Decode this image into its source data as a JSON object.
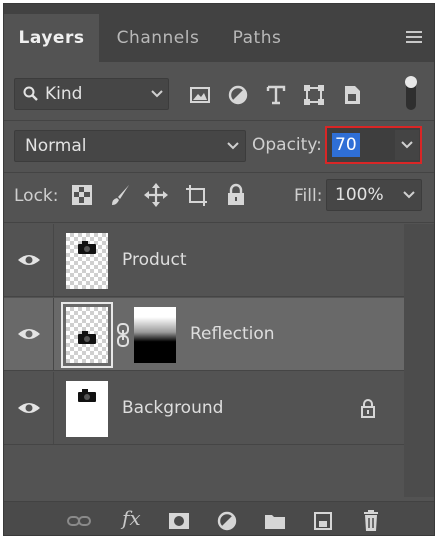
{
  "tabs": [
    {
      "label": "Layers",
      "active": true
    },
    {
      "label": "Channels",
      "active": false
    },
    {
      "label": "Paths",
      "active": false
    }
  ],
  "filter": {
    "kind_label": "Kind",
    "filter_icons": [
      "image-filter-icon",
      "adjustment-filter-icon",
      "type-filter-icon",
      "shape-filter-icon",
      "smart-object-filter-icon"
    ],
    "toggle_icon": "filter-toggle-icon"
  },
  "blend": {
    "mode": "Normal",
    "opacity_label": "Opacity:",
    "opacity_value": "70"
  },
  "lock": {
    "label": "Lock:",
    "icons": [
      "lock-transparent-pixels-icon",
      "lock-image-pixels-icon",
      "lock-position-icon",
      "lock-artboard-icon",
      "lock-all-icon"
    ],
    "fill_label": "Fill:",
    "fill_value": "100%"
  },
  "layers": [
    {
      "name": "Product",
      "visible": true,
      "selected": false,
      "has_mask": false,
      "locked": false
    },
    {
      "name": "Reflection",
      "visible": true,
      "selected": true,
      "has_mask": true,
      "locked": false
    },
    {
      "name": "Background",
      "visible": true,
      "selected": false,
      "has_mask": false,
      "locked": true
    }
  ],
  "bottom_bar": {
    "fx_label": "fx",
    "icons": [
      "link-layers-icon",
      "layer-style-icon",
      "add-mask-icon",
      "adjustment-layer-icon",
      "new-group-icon",
      "new-layer-icon",
      "delete-layer-icon"
    ]
  },
  "colors": {
    "panel_bg": "#535353",
    "selected_layer_bg": "#696969",
    "highlight_border": "#d92626",
    "selection_blue": "#2f6fd6"
  }
}
